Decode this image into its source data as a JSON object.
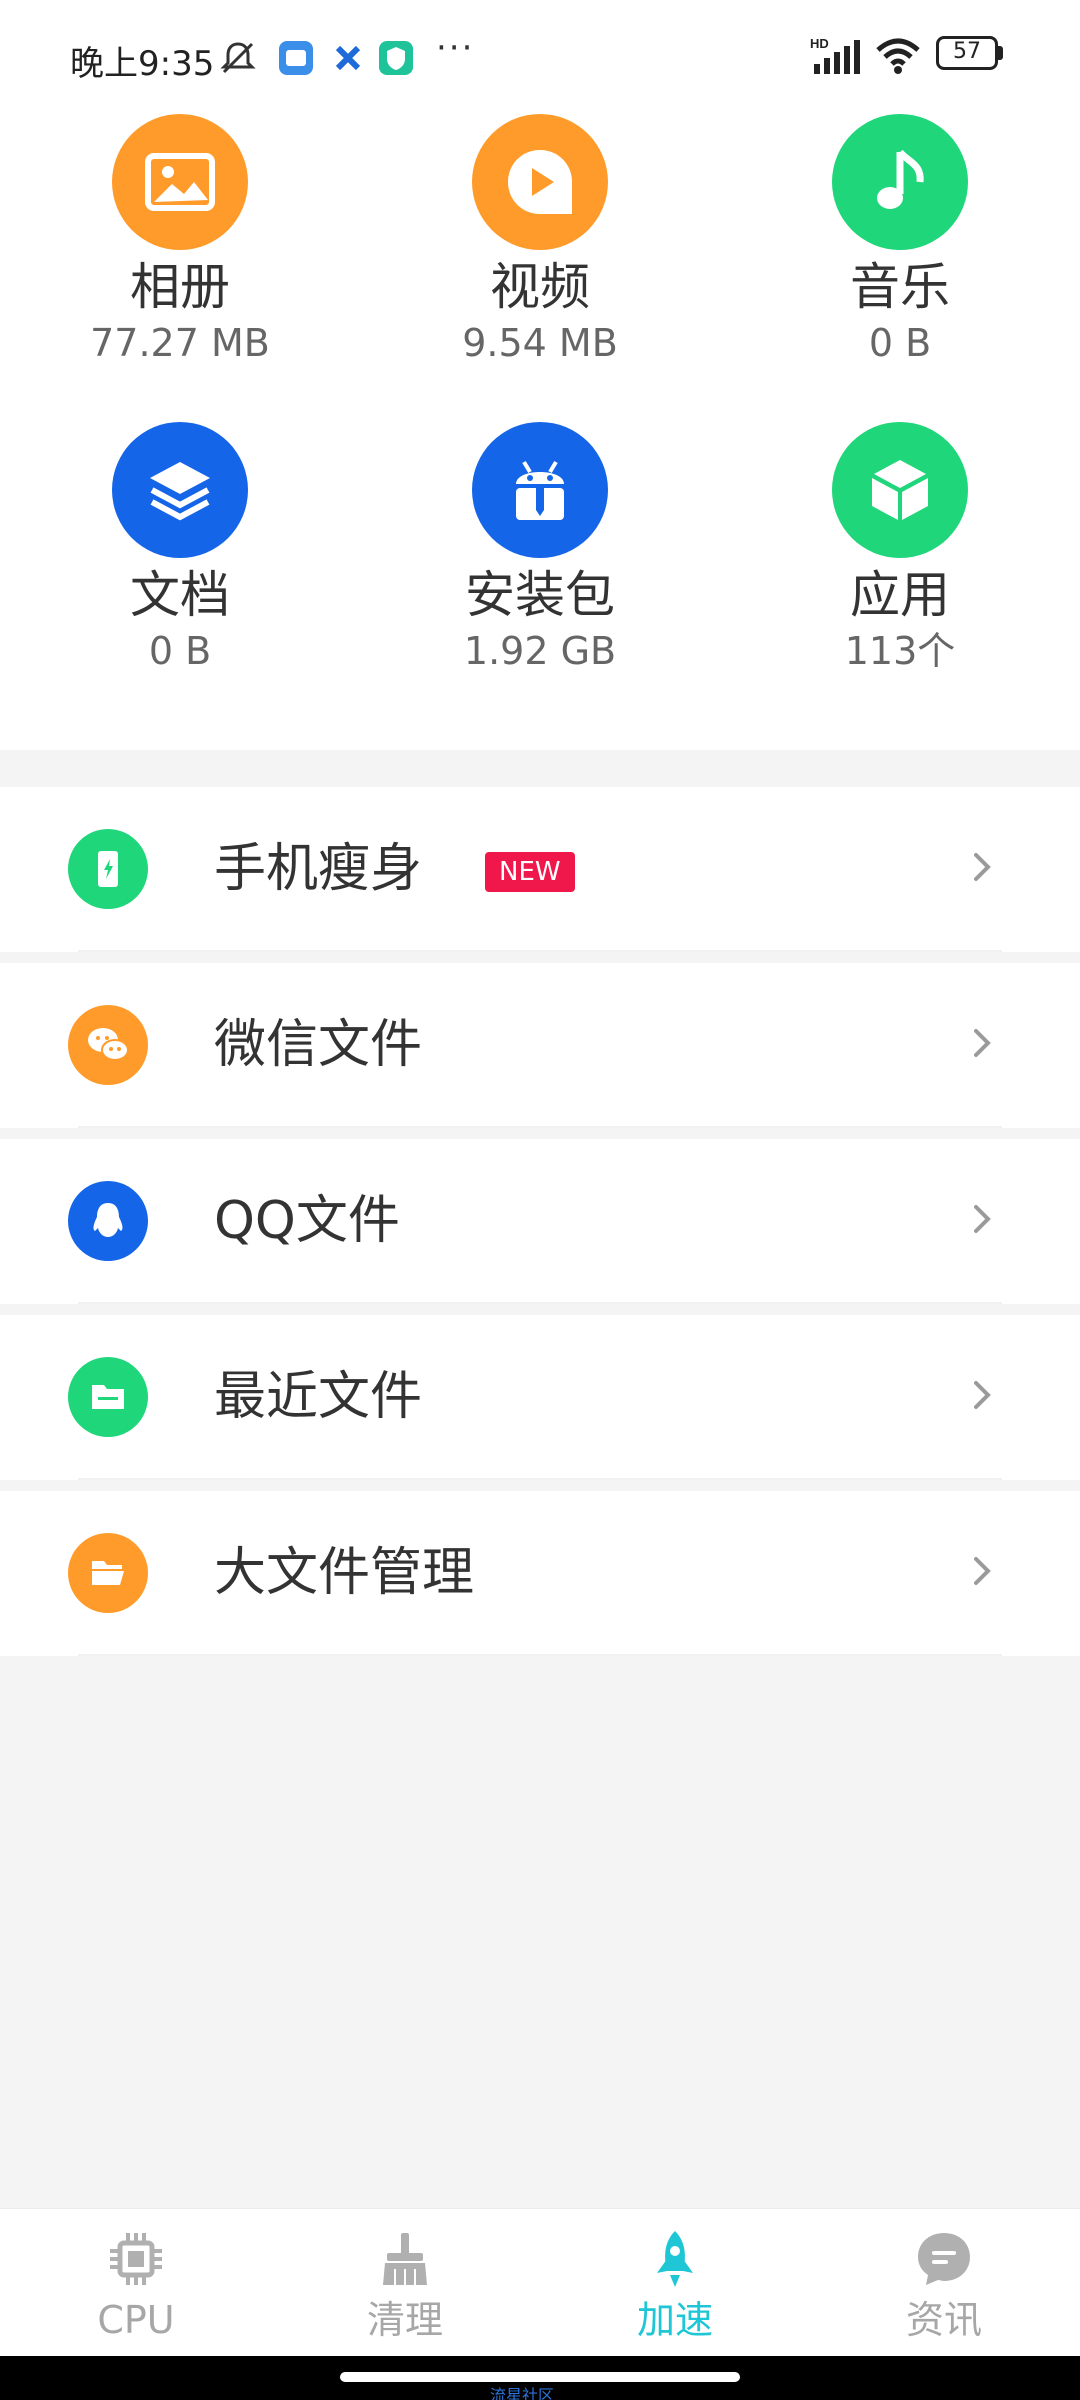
{
  "status_bar": {
    "time": "晚上9:35",
    "battery": "57",
    "signal_label": "HD"
  },
  "categories": [
    {
      "name": "相册",
      "size": "77.27 MB",
      "icon": "image-icon",
      "color": "#ff9b2b"
    },
    {
      "name": "视频",
      "size": "9.54 MB",
      "icon": "play-icon",
      "color": "#ff9b2b"
    },
    {
      "name": "音乐",
      "size": "0 B",
      "icon": "music-note-icon",
      "color": "#1fd67a"
    },
    {
      "name": "文档",
      "size": "0 B",
      "icon": "layers-icon",
      "color": "#1565e8"
    },
    {
      "name": "安装包",
      "size": "1.92 GB",
      "icon": "android-package-icon",
      "color": "#1565e8"
    },
    {
      "name": "应用",
      "size": "113个",
      "icon": "cube-icon",
      "color": "#1fd67a"
    }
  ],
  "list": [
    {
      "label": "手机瘦身",
      "badge": "NEW",
      "icon": "phone-slim-icon",
      "color": "#1fd67a"
    },
    {
      "label": "微信文件",
      "icon": "wechat-icon",
      "color": "#ff9b2b"
    },
    {
      "label": "QQ文件",
      "icon": "qq-penguin-icon",
      "color": "#1565e8"
    },
    {
      "label": "最近文件",
      "icon": "folder-icon",
      "color": "#1fd67a"
    },
    {
      "label": "大文件管理",
      "icon": "open-folder-icon",
      "color": "#ff9b2b"
    }
  ],
  "bottom_nav": [
    {
      "label": "CPU",
      "icon": "chip-icon",
      "active": false
    },
    {
      "label": "清理",
      "icon": "broom-icon",
      "active": false
    },
    {
      "label": "加速",
      "icon": "rocket-icon",
      "active": true
    },
    {
      "label": "资讯",
      "icon": "chat-bubble-icon",
      "active": false
    }
  ],
  "colors": {
    "accent": "#1fc6d6",
    "orange": "#ff9b2b",
    "green": "#1fd67a",
    "blue": "#1565e8",
    "badge_red": "#f0174a"
  },
  "watermark": "流星社区"
}
